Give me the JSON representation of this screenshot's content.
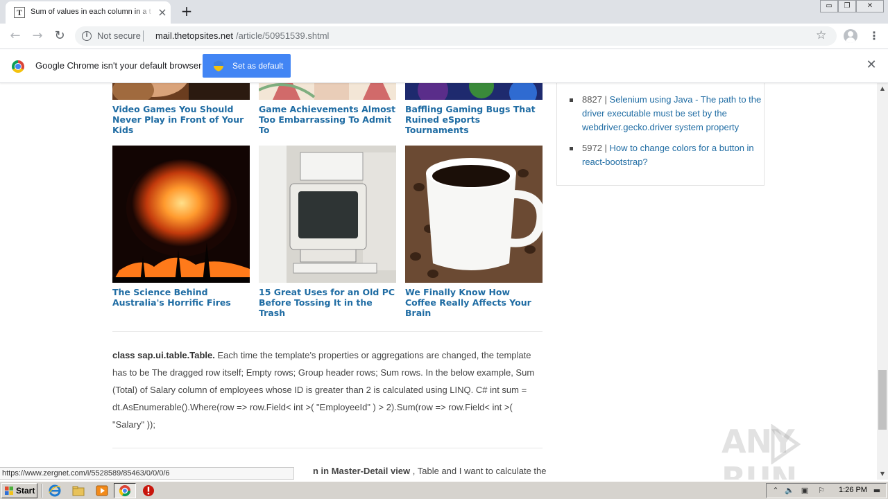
{
  "browser": {
    "tab_title": "Sum of values in each column in a table",
    "tab_favicon_letter": "T",
    "security_label": "Not secure",
    "url_host": "mail.thetopsites.net",
    "url_path": "/article/50951539.shtml",
    "window_buttons": {
      "minimize": "▭",
      "maximize": "❐",
      "close": "✕"
    }
  },
  "infobar": {
    "message": "Google Chrome isn't your default browser",
    "button_label": "Set as default",
    "accent": "#4285f4"
  },
  "cards": [
    {
      "title": "Video Games You Should Never Play in Front of Your Kids"
    },
    {
      "title": "Game Achievements Almost Too Embarrassing To Admit To"
    },
    {
      "title": "Baffling Gaming Bugs That Ruined eSports Tournaments"
    },
    {
      "title": "The Science Behind Australia's Horrific Fires"
    },
    {
      "title": "15 Great Uses for an Old PC Before Tossing It in the Trash"
    },
    {
      "title": "We Finally Know How Coffee Really Affects Your Brain"
    }
  ],
  "article": {
    "p1_bold": "class sap.ui.table.Table.",
    "p1_rest": " Each time the template's properties or aggregations are changed, the template has to be The dragged row itself; Empty rows; Group header rows; Sum rows. In the below example, Sum (Total) of Salary column of employees whose ID is greater than 2 is calculated using LINQ. C# int sum = dt.AsEnumerable().Where(row => row.Field< int >( \"EmployeeId\" ) > 2).Sum(row => row.Field< int >( \"Salary\" ));",
    "p2_bold": "n in Master-Detail view",
    "p2_rest": " , Table and I want to calculate the"
  },
  "sidebar": {
    "items": [
      {
        "count": "8827",
        "sep": " | ",
        "link": "Selenium using Java - The path to the driver executable must be set by the webdriver.gecko.driver system property"
      },
      {
        "count": "5972",
        "sep": " | ",
        "link": "How to change colors for a button in react-bootstrap?"
      }
    ]
  },
  "status_bar": {
    "url": "https://www.zergnet.com/i/5528589/85463/0/0/0/6"
  },
  "watermark": {
    "left": "ANY",
    "right": "RUN"
  },
  "taskbar": {
    "start_label": "Start",
    "clock": "1:26 PM"
  },
  "colors": {
    "link": "#1f6ca3",
    "tab_bar": "#dee1e6",
    "taskbar": "#d6d3ce"
  }
}
